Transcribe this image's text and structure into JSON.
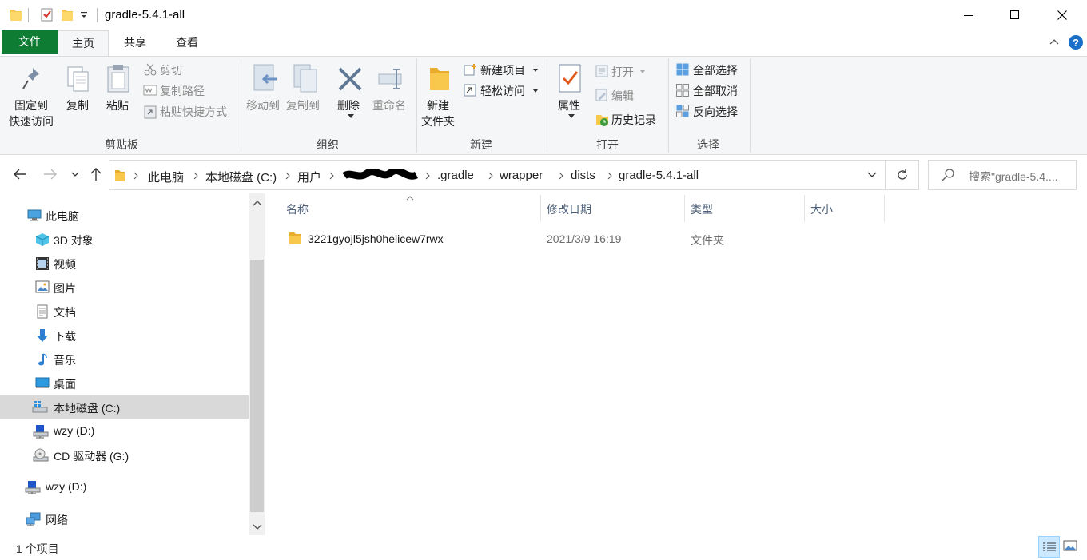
{
  "window": {
    "title": "gradle-5.4.1-all",
    "minimize_icon": "minimize-icon",
    "maximize_icon": "maximize-icon",
    "close_icon": "close-icon"
  },
  "ribbon_tabs": {
    "file": "文件",
    "home": "主页",
    "share": "共享",
    "view": "查看"
  },
  "ribbon": {
    "clipboard": {
      "pin_line1": "固定到",
      "pin_line2": "快速访问",
      "copy": "复制",
      "paste": "粘贴",
      "cut": "剪切",
      "copy_path": "复制路径",
      "paste_shortcut": "粘贴快捷方式",
      "group": "剪贴板"
    },
    "organize": {
      "move_to": "移动到",
      "copy_to": "复制到",
      "delete": "删除",
      "rename": "重命名",
      "group": "组织"
    },
    "new": {
      "new_folder_line1": "新建",
      "new_folder_line2": "文件夹",
      "new_item": "新建项目",
      "easy_access": "轻松访问",
      "group": "新建"
    },
    "open": {
      "properties": "属性",
      "open": "打开",
      "edit": "编辑",
      "history": "历史记录",
      "group": "打开"
    },
    "select": {
      "select_all": "全部选择",
      "select_none": "全部取消",
      "invert": "反向选择",
      "group": "选择"
    }
  },
  "address": {
    "crumbs": [
      "此电脑",
      "本地磁盘 (C:)",
      "用户",
      ".gradle",
      "wrapper",
      "dists",
      "gradle-5.4.1-all"
    ],
    "search_placeholder": "搜索\"gradle-5.4...."
  },
  "nav": {
    "this_pc": "此电脑",
    "objects3d": "3D 对象",
    "videos": "视频",
    "pictures": "图片",
    "documents": "文档",
    "downloads": "下载",
    "music": "音乐",
    "desktop": "桌面",
    "local_disk": "本地磁盘 (C:)",
    "wzy_d": "wzy (D:)",
    "cd_drive": "CD 驱动器 (G:)",
    "wzy_d2": "wzy (D:)",
    "network": "网络"
  },
  "columns": {
    "name": "名称",
    "modified": "修改日期",
    "type": "类型",
    "size": "大小"
  },
  "files": [
    {
      "name": "3221gyojl5jsh0helicew7rwx",
      "modified": "2021/3/9 16:19",
      "type": "文件夹",
      "size": ""
    }
  ],
  "status": {
    "count": "1 个项目"
  },
  "colors": {
    "file_tab": "#0e7c33",
    "selected_nav": "#cce8ff",
    "folder": "#f8c84c",
    "header_text": "#4c607a"
  }
}
